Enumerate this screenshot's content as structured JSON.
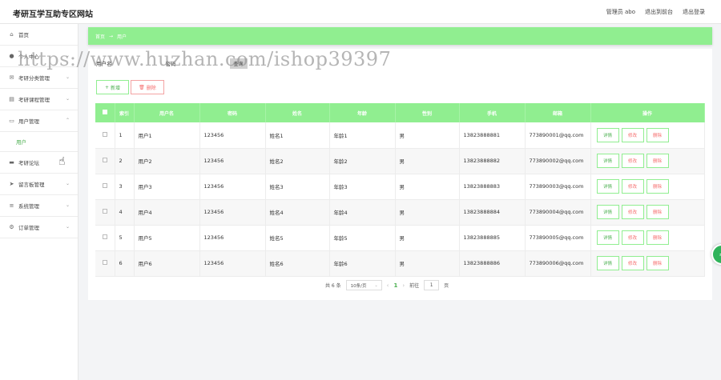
{
  "header": {
    "site_title": "考研互学互助专区网站",
    "admin_label": "管理员 abo",
    "backend_link": "退出到前台",
    "logout_link": "退出登录"
  },
  "sidebar": {
    "items": [
      {
        "label": "首页",
        "icon": "home-icon"
      },
      {
        "label": "个人中心",
        "icon": "user-icon"
      },
      {
        "label": "考研分类管理",
        "icon": "mail-icon"
      },
      {
        "label": "考研课程管理",
        "icon": "book-icon"
      },
      {
        "label": "用户管理",
        "icon": "document-icon"
      },
      {
        "label": "考研论坛",
        "icon": "chat-icon"
      },
      {
        "label": "留言板管理",
        "icon": "send-icon"
      },
      {
        "label": "系统管理",
        "icon": "list-icon"
      },
      {
        "label": "订单管理",
        "icon": "settings-icon"
      }
    ],
    "active_sub": "用户"
  },
  "breadcrumb": {
    "home": "首页",
    "separator": "→",
    "current": "用户"
  },
  "search": {
    "field1_label": "用户名",
    "field2_label": "密码",
    "button_label": "查询"
  },
  "toolbar": {
    "add_label": "新增",
    "delete_label": "删除"
  },
  "table": {
    "headers": [
      "索引",
      "用户名",
      "密码",
      "姓名",
      "年龄",
      "性别",
      "手机",
      "邮箱",
      "操作"
    ],
    "rows": [
      [
        "1",
        "用户1",
        "123456",
        "姓名1",
        "年龄1",
        "男",
        "13823888881",
        "773890001@qq.com"
      ],
      [
        "2",
        "用户2",
        "123456",
        "姓名2",
        "年龄2",
        "男",
        "13823888882",
        "773890002@qq.com"
      ],
      [
        "3",
        "用户3",
        "123456",
        "姓名3",
        "年龄3",
        "男",
        "13823888883",
        "773890003@qq.com"
      ],
      [
        "4",
        "用户4",
        "123456",
        "姓名4",
        "年龄4",
        "男",
        "13823888884",
        "773890004@qq.com"
      ],
      [
        "5",
        "用户5",
        "123456",
        "姓名5",
        "年龄5",
        "男",
        "13823888885",
        "773890005@qq.com"
      ],
      [
        "6",
        "用户6",
        "123456",
        "姓名6",
        "年龄6",
        "男",
        "13823888886",
        "773890006@qq.com"
      ]
    ],
    "ops": {
      "view": "详情",
      "edit": "修改",
      "delete": "删除"
    }
  },
  "pagination": {
    "total_text": "共 6 条",
    "page_size": "10条/页",
    "prev": "‹",
    "current_page": "1",
    "next": "›",
    "goto_prefix": "前往",
    "goto_value": "1",
    "goto_suffix": "页"
  },
  "watermark": "https://www.huzhan.com/ishop39397",
  "colors": {
    "accent": "#90ee90",
    "danger": "#f56c6c",
    "active_text": "#4caf50"
  }
}
